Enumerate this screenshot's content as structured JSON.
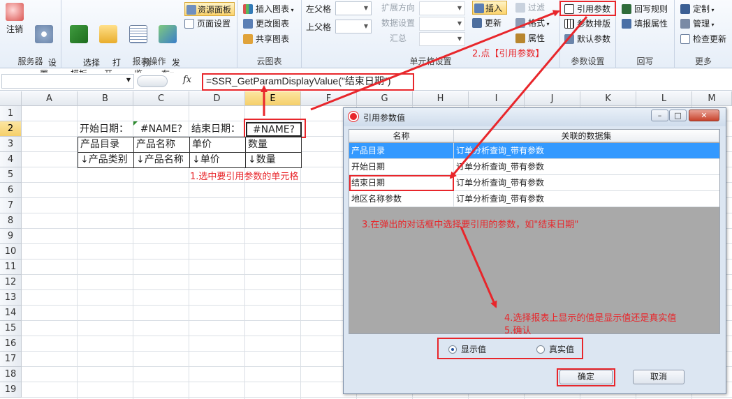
{
  "ribbon": {
    "server": {
      "label": "服务器",
      "login": "注销",
      "settings": "设\n置"
    },
    "report_ops": {
      "label": "报表操作",
      "select_template": "选择\n模板",
      "open": "打\n开",
      "preview": "预\n览",
      "publish": "发\n布▾"
    },
    "resource_panel": "资源面板",
    "page_setup": "页面设置",
    "cloud": {
      "label": "云图表",
      "insert_chart": "插入图表",
      "change_chart": "更改图表",
      "share_chart": "共享图表"
    },
    "cell": {
      "label": "单元格设置",
      "left_parent": "左父格",
      "top_parent": "上父格",
      "expand_dir": "扩展方向",
      "data_setting": "数据设置",
      "summary": "汇总",
      "insert": "插入",
      "filter": "过滤",
      "format": "格式",
      "property": "属性",
      "update": "更新"
    },
    "param": {
      "label": "参数设置",
      "ref_param": "引用参数",
      "param_layout": "参数排版",
      "default_param": "默认参数"
    },
    "writeback": {
      "label": "回写",
      "rule": "回写规则",
      "fill_prop": "填报属性"
    },
    "more": {
      "label": "更多",
      "custom": "定制",
      "manage": "管理",
      "check_update": "检查更新"
    }
  },
  "formula_bar": {
    "fx": "fx",
    "formula": "=SSR_GetParamDisplayValue(\"结束日期\")"
  },
  "columns": [
    "A",
    "B",
    "C",
    "D",
    "E",
    "F",
    "G",
    "H",
    "I",
    "J",
    "K",
    "L",
    "M"
  ],
  "rows": [
    "1",
    "2",
    "3",
    "4",
    "5",
    "6",
    "7",
    "8",
    "9",
    "10",
    "11",
    "12",
    "13",
    "14",
    "15",
    "16",
    "17",
    "18",
    "19"
  ],
  "sheet": {
    "start_date_label": "开始日期：",
    "start_date_value": "#NAME?",
    "end_date_label": "结束日期：",
    "end_date_value": "#NAME?",
    "headers": [
      "产品目录",
      "产品名称",
      "单价",
      "数量"
    ],
    "fields": [
      "↓产品类别",
      "↓产品名称",
      "↓单价",
      "↓数量"
    ]
  },
  "annotations": {
    "step1": "1.选中要引用参数的单元格",
    "step2": "2.点【引用参数】",
    "step3": "3.在弹出的对话框中选择要引用的参数，如\"结束日期\"",
    "step4": "4.选择报表上显示的值是显示值还是真实值",
    "step5": "5.确认"
  },
  "dialog": {
    "title": "引用参数值",
    "col_name": "名称",
    "col_dataset": "关联的数据集",
    "rows": [
      {
        "name": "产品目录",
        "dataset": "订单分析查询_带有参数",
        "selected": true
      },
      {
        "name": "开始日期",
        "dataset": "订单分析查询_带有参数",
        "selected": false
      },
      {
        "name": "结束日期",
        "dataset": "订单分析查询_带有参数",
        "selected": false
      },
      {
        "name": "地区名称参数",
        "dataset": "订单分析查询_带有参数",
        "selected": false
      }
    ],
    "radio_display": "显示值",
    "radio_real": "真实值",
    "ok": "确定",
    "cancel": "取消"
  },
  "colors": {
    "accent_red": "#e8262b",
    "selection_blue": "#3399ff",
    "header_highlight": "#f5cf6a"
  }
}
